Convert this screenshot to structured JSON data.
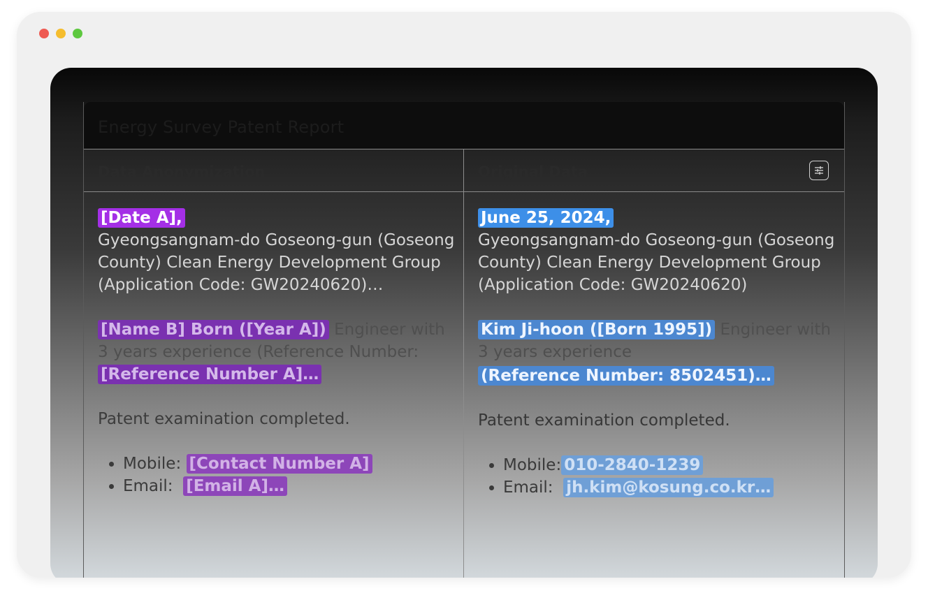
{
  "window": {
    "controls": {
      "close_color": "#ee5a52",
      "minimize_color": "#f5bd2e",
      "maximize_color": "#5ec83f"
    }
  },
  "report": {
    "title": "Energy Survey Patent Report",
    "filter_icon": "sliders-icon",
    "left": {
      "header": "Data Anonymization",
      "date": "[Date A],",
      "location": "Gyeongsangnam-do Goseong-gun (Goseong County) Clean Energy Development Group (Application Code: GW20240620)…",
      "person": "[Name B] Born ([Year A])",
      "role": "Engineer with 3 years experience (Reference Number:",
      "reference": "[Reference Number A]…",
      "status": "Patent examination completed.",
      "mobile_label": "Mobile:",
      "mobile": "[Contact Number A]",
      "email_label": "Email:",
      "email": "[Email A]…"
    },
    "right": {
      "header": "Original Data",
      "date": "June 25, 2024,",
      "location": "Gyeongsangnam-do Goseong-gun (Goseong County) Clean Energy Development Group (Application Code: GW20240620)",
      "person": "Kim Ji-hoon ([Born 1995])",
      "role": "Engineer with 3 years experience",
      "reference": "(Reference Number: 8502451)…",
      "status": "Patent examination completed.",
      "mobile_label": "Mobile:",
      "mobile": "010-2840-1239",
      "email_label": "Email:",
      "email": "jh.kim@kosung.co.kr…"
    }
  }
}
